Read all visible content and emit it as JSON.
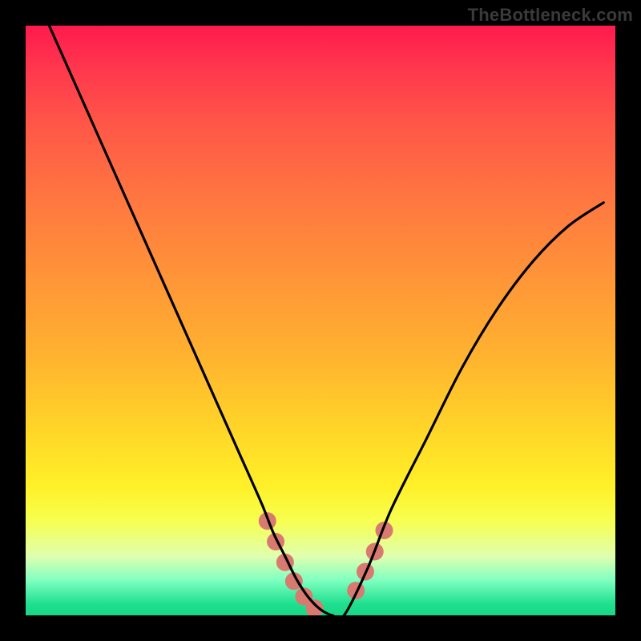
{
  "watermark": "TheBottleneck.com",
  "colors": {
    "bead": "#d97a70",
    "curve": "#000000",
    "frame": "#000000"
  },
  "chart_data": {
    "type": "line",
    "title": "",
    "xlabel": "",
    "ylabel": "",
    "xlim": [
      0,
      100
    ],
    "ylim": [
      0,
      100
    ],
    "grid": false,
    "legend": false,
    "series": [
      {
        "name": "bottleneck-curve",
        "x": [
          4,
          8,
          12,
          16,
          20,
          24,
          28,
          32,
          36,
          40,
          42,
          44,
          46,
          48,
          50,
          52,
          54,
          58,
          62,
          68,
          74,
          80,
          86,
          92,
          98
        ],
        "y": [
          100,
          91,
          82,
          73,
          64,
          55,
          46,
          37,
          28,
          19,
          14,
          10,
          6,
          3,
          1,
          0,
          0,
          8,
          18,
          30,
          42,
          52,
          60,
          66,
          70
        ]
      }
    ],
    "markers": [
      {
        "name": "bead",
        "x": 41.0,
        "y": 16.0
      },
      {
        "name": "bead",
        "x": 42.4,
        "y": 12.5
      },
      {
        "name": "bead",
        "x": 44.0,
        "y": 9.0
      },
      {
        "name": "bead",
        "x": 45.5,
        "y": 5.8
      },
      {
        "name": "bead",
        "x": 47.2,
        "y": 3.2
      },
      {
        "name": "bead",
        "x": 49.0,
        "y": 1.2
      },
      {
        "name": "bead",
        "x": 56.0,
        "y": 4.2
      },
      {
        "name": "bead",
        "x": 57.6,
        "y": 7.4
      },
      {
        "name": "bead",
        "x": 59.2,
        "y": 10.8
      },
      {
        "name": "bead",
        "x": 60.8,
        "y": 14.4
      }
    ],
    "gradient_stops": [
      {
        "pos": 0.0,
        "color": "#ff1a4d"
      },
      {
        "pos": 0.08,
        "color": "#ff3a4d"
      },
      {
        "pos": 0.18,
        "color": "#ff5a47"
      },
      {
        "pos": 0.3,
        "color": "#ff7840"
      },
      {
        "pos": 0.42,
        "color": "#ff9338"
      },
      {
        "pos": 0.55,
        "color": "#ffb030"
      },
      {
        "pos": 0.68,
        "color": "#ffd428"
      },
      {
        "pos": 0.78,
        "color": "#fff028"
      },
      {
        "pos": 0.84,
        "color": "#f7ff50"
      },
      {
        "pos": 0.9,
        "color": "#e0ffb0"
      },
      {
        "pos": 0.94,
        "color": "#80ffc0"
      },
      {
        "pos": 0.98,
        "color": "#20e090"
      },
      {
        "pos": 1.0,
        "color": "#18d888"
      }
    ]
  }
}
